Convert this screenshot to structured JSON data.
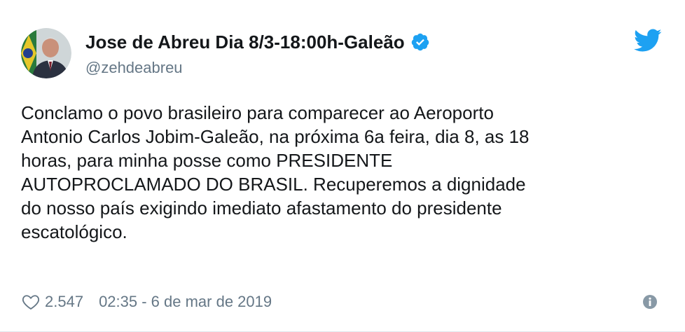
{
  "tweet": {
    "author": {
      "display_name": "Jose de Abreu Dia 8/3-18:00h-Galeão",
      "handle": "@zehdeabreu",
      "verified": true
    },
    "text_lines": [
      "Conclamo o povo brasileiro para comparecer ao Aeroporto",
      "Antonio Carlos Jobim-Galeão, na próxima 6a feira, dia 8, as 18",
      "horas, para minha posse como PRESIDENTE",
      "AUTOPROCLAMADO DO BRASIL. Recuperemos a dignidade",
      "do nosso país exigindo imediato afastamento do presidente",
      "escatológico."
    ],
    "likes": "2.547",
    "timestamp": "02:35 - 6 de mar de 2019"
  },
  "icons": {
    "verified": "verified-badge-icon",
    "twitter": "twitter-bird-icon",
    "like": "heart-icon",
    "info": "info-icon"
  },
  "colors": {
    "text": "#14171a",
    "secondary": "#657786",
    "twitter_blue": "#1da1f2"
  }
}
